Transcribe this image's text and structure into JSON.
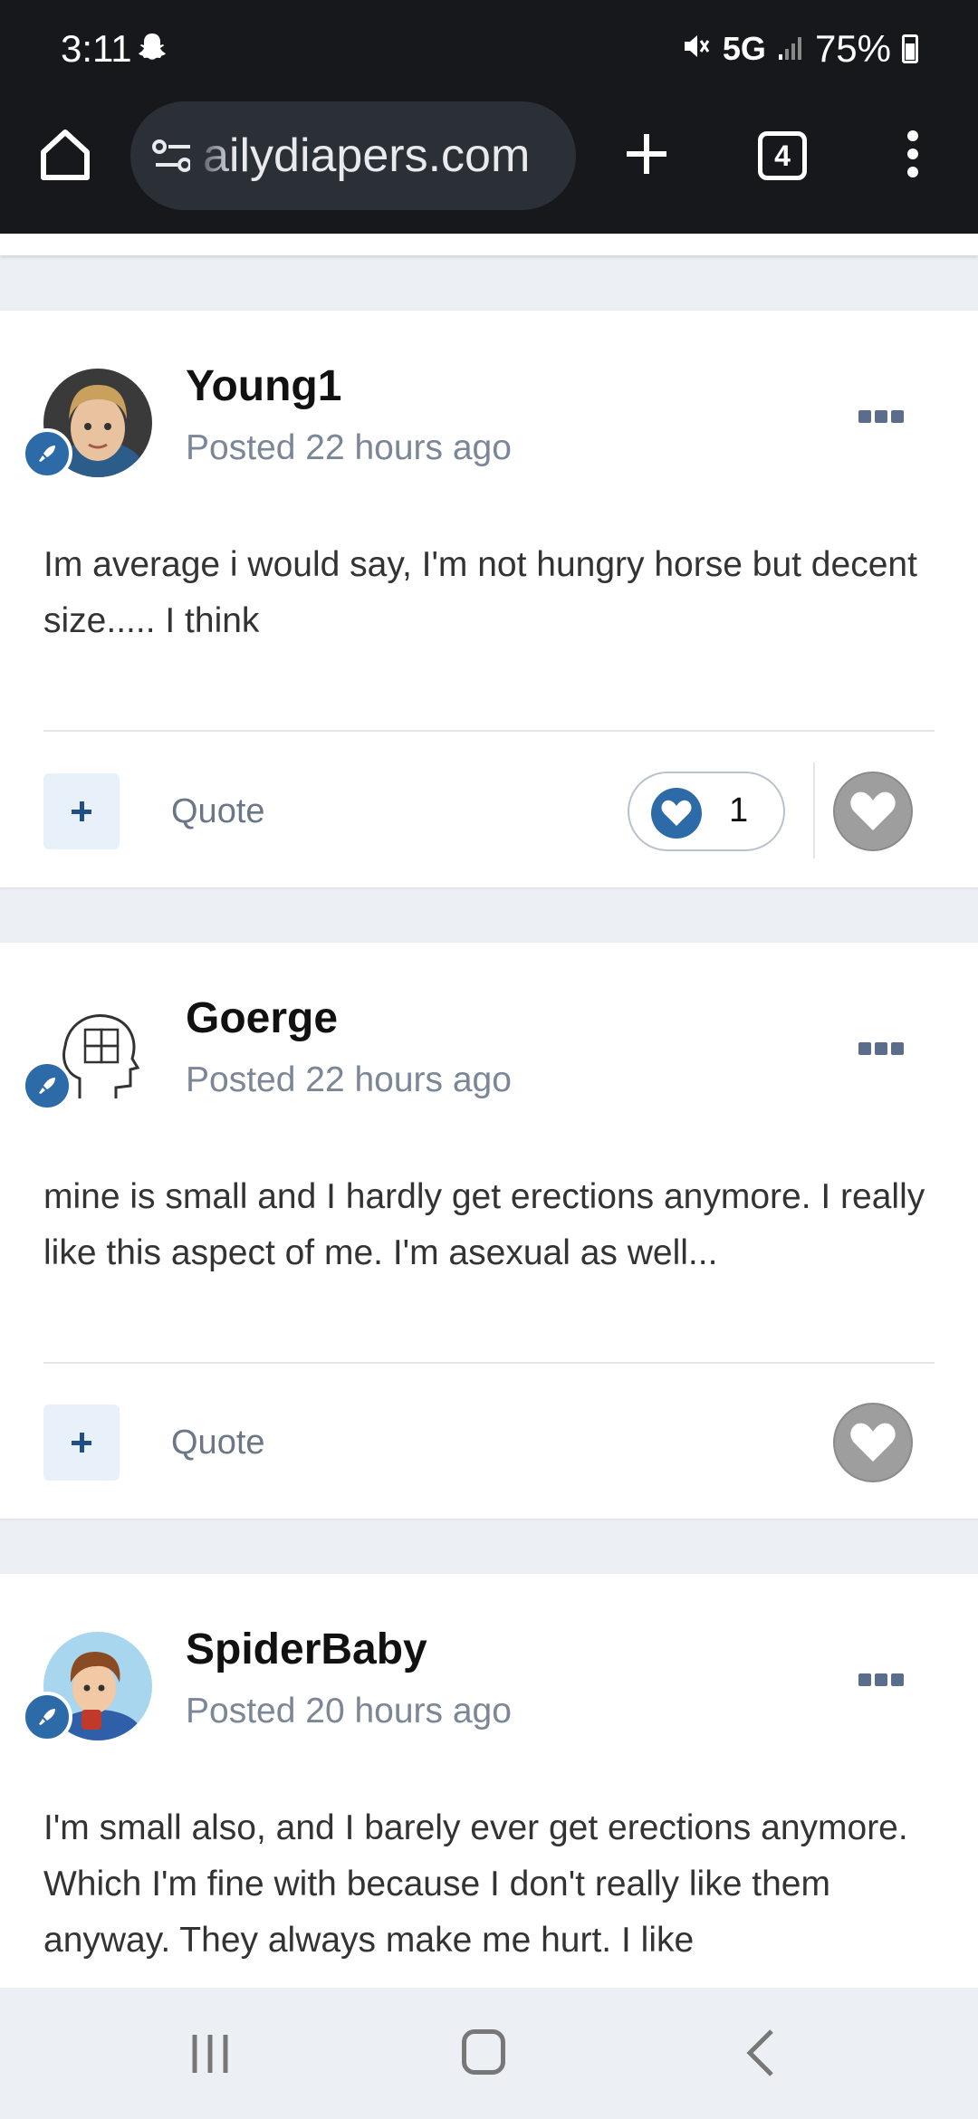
{
  "status_bar": {
    "time": "3:11",
    "network": "5G",
    "battery": "75%"
  },
  "browser": {
    "url": "ailydiapers.com",
    "tab_count": "4"
  },
  "posts": [
    {
      "author": "Young1",
      "posted": "Posted 22 hours ago",
      "text": "Im average i would say, I'm not hungry horse but decent size..... I think",
      "quote_label": "Quote",
      "reaction_count": "1"
    },
    {
      "author": "Goerge",
      "posted": "Posted 22 hours ago",
      "text": "mine is small and I hardly get erections anymore. I really like this aspect of me. I'm asexual as well...",
      "quote_label": "Quote"
    },
    {
      "author": "SpiderBaby",
      "posted": "Posted 20 hours ago",
      "text": "I'm small also, and I barely ever get erections anymore. Which I'm fine with because I don't really like them anyway. They always make me hurt. I like"
    }
  ],
  "colors": {
    "accent": "#2d6aa8",
    "page_bg": "#eceff3",
    "card_bg": "#ffffff",
    "meta_text": "#7b8797"
  },
  "icons": [
    "snapchat-icon",
    "mute-icon",
    "signal-icon",
    "battery-icon",
    "home-icon",
    "tune-icon",
    "plus-icon",
    "tabs-icon",
    "overflow-menu-icon",
    "rocket-icon",
    "heart-icon",
    "recents-icon",
    "home-nav-icon",
    "back-icon"
  ]
}
